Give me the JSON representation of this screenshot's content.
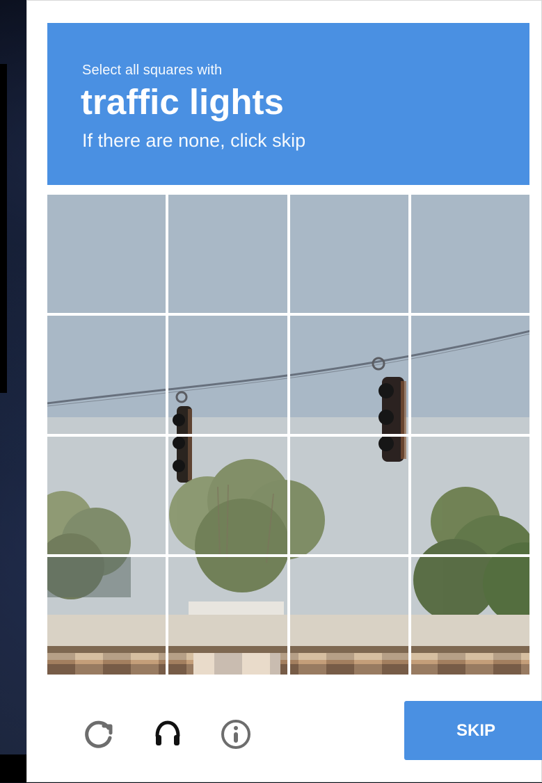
{
  "captcha": {
    "instruction_prefix": "Select all squares with",
    "target": "traffic lights",
    "subtext": "If there are none, click skip"
  },
  "grid": {
    "rows": 4,
    "cols": 4
  },
  "footer": {
    "skip_label": "SKIP",
    "icons": [
      "reload-icon",
      "audio-icon",
      "info-icon"
    ]
  },
  "colors": {
    "accent": "#4a90e2",
    "background": "#ffffff",
    "page": "#060a12"
  }
}
